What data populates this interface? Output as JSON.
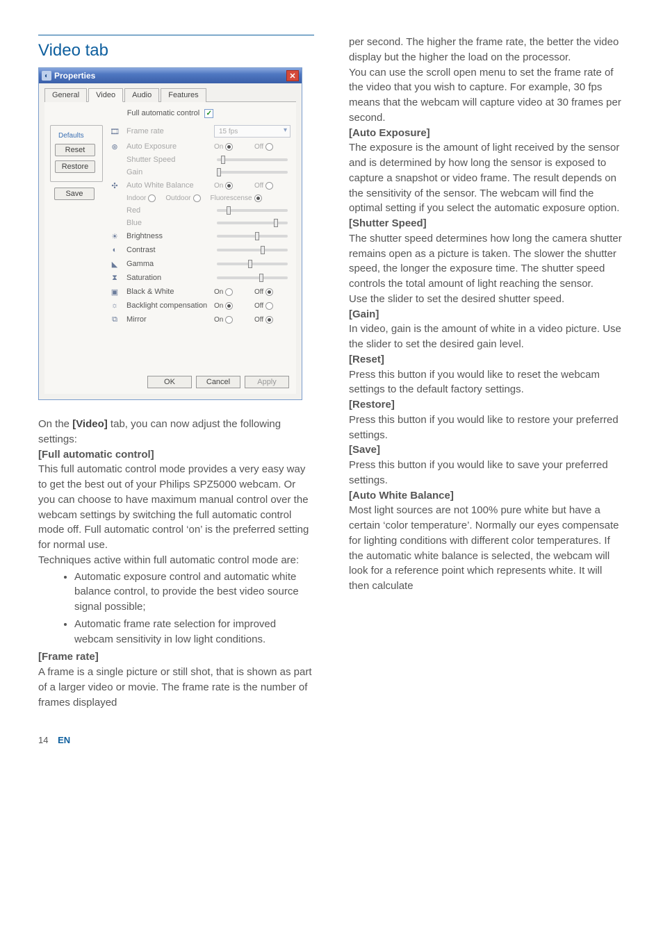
{
  "heading": "Video tab",
  "properties": {
    "title": "Properties",
    "tabs": [
      "General",
      "Video",
      "Audio",
      "Features"
    ],
    "active_tab": 1,
    "full_auto_label": "Full automatic control",
    "defaults": {
      "legend": "Defaults",
      "reset": "Reset",
      "restore": "Restore",
      "save": "Save"
    },
    "frame_rate": {
      "label": "Frame rate",
      "value": "15 fps"
    },
    "auto_exposure": {
      "label": "Auto Exposure",
      "on": "On",
      "off": "Off"
    },
    "shutter": {
      "label": "Shutter Speed"
    },
    "gain": {
      "label": "Gain"
    },
    "awb": {
      "label": "Auto White Balance",
      "on": "On",
      "off": "Off"
    },
    "wb_opts": {
      "indoor": "Indoor",
      "outdoor": "Outdoor",
      "fluor": "Fluorescense"
    },
    "red": "Red",
    "blue": "Blue",
    "brightness": "Brightness",
    "contrast": "Contrast",
    "gamma": "Gamma",
    "saturation": "Saturation",
    "bw": {
      "label": "Black & White",
      "on": "On",
      "off": "Off"
    },
    "backlight": {
      "label": "Backlight compensation",
      "on": "On",
      "off": "Off"
    },
    "mirror": {
      "label": "Mirror",
      "on": "On",
      "off": "Off"
    },
    "buttons": {
      "ok": "OK",
      "cancel": "Cancel",
      "apply": "Apply"
    }
  },
  "left": {
    "p1a": "On the ",
    "p1b": "[Video]",
    "p1c": " tab, you can now adjust the following settings:",
    "fac_h": "[Full automatic control]",
    "fac_p": "This full automatic control mode provides a very easy way to get the best out of your Philips SPZ5000 webcam. Or you can choose to have maximum manual control over the webcam settings by switching the full automatic control mode off. Full automatic control ‘on’ is the preferred setting for normal use.",
    "fac_tp": "Techniques active within full automatic control mode are:",
    "li1": "Automatic exposure control and automatic white balance control, to provide the best video source signal possible;",
    "li2": "Automatic frame rate selection for improved webcam sensitivity in low light conditions.",
    "fr_h": "[Frame rate]",
    "fr_p": "A frame is a single picture or still shot, that is shown as part of a larger video or movie. The frame rate is the number of frames displayed"
  },
  "right": {
    "fr_cont": "per second. The higher the frame rate, the better the video display but the higher the load on the processor.",
    "fr_p2": "You can use the scroll open menu to set the frame rate of the video that you wish to capture. For example, 30 fps means that the webcam will capture video at 30 frames per second.",
    "ae_h": "[Auto Exposure]",
    "ae_p": "The exposure is the amount of light received by the sensor and is determined by how long the sensor is exposed to capture a snapshot or video frame. The result depends on the sensitivity of the sensor. The webcam will find the optimal setting if you select the automatic exposure option.",
    "ss_h": "[Shutter Speed]",
    "ss_p": "The shutter speed determines how long the camera shutter remains open as a picture is taken. The slower the shutter speed, the longer the exposure time. The shutter speed controls the total amount of light reaching the sensor.",
    "ss_p2": "Use the slider to set the desired shutter speed.",
    "g_h": "[Gain]",
    "g_p": "In video, gain is the amount of white in a video picture. Use the slider to set the desired gain level.",
    "r_h": "[Reset]",
    "r_p": "Press this button if you would like to reset the webcam settings to the default factory settings.",
    "re_h": "[Restore]",
    "re_p": "Press this button if you would like to restore your preferred settings.",
    "s_h": "[Save]",
    "s_p": "Press this button if you would like to save your preferred settings.",
    "awb_h": "[Auto White Balance]",
    "awb_p": "Most light sources are not 100% pure white but have a certain ‘color temperature’. Normally our eyes compensate for lighting conditions with different color temperatures. If the automatic white balance is selected, the webcam will look for a reference point which represents white. It will then calculate"
  },
  "footer": {
    "page": "14",
    "lang": "EN"
  }
}
